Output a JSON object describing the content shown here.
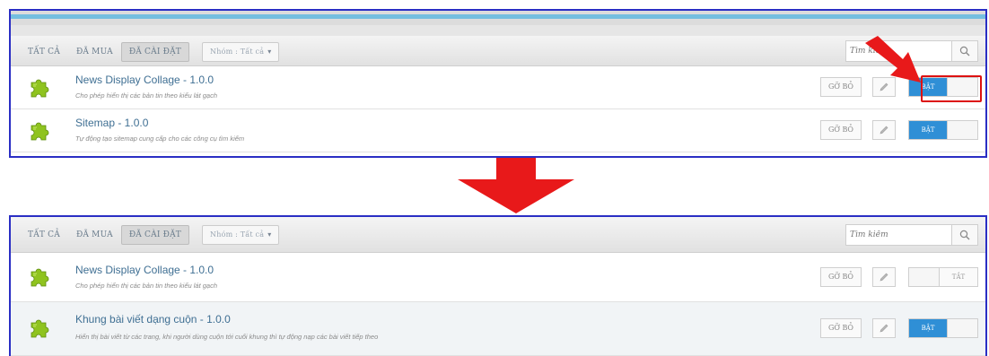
{
  "colors": {
    "accent_blue": "#2f8fd6",
    "highlight_red": "#dd1111",
    "panel_border": "#2a2ec4",
    "title_link": "#3f6f93"
  },
  "top": {
    "tabs": {
      "all": "TẤT CẢ",
      "purchased": "ĐÃ MUA",
      "installed": "ĐÃ CÀI ĐẶT",
      "filter": "Nhóm : Tất cả"
    },
    "search": {
      "placeholder": "Tìm kiếm"
    },
    "rows": [
      {
        "title": "News Display Collage - 1.0.0",
        "desc": "Cho phép hiển thị các bản tin theo kiểu lát gạch",
        "remove": "GỠ BỎ",
        "toggle": "BẬT"
      },
      {
        "title": "Sitemap - 1.0.0",
        "desc": "Tự động tạo sitemap cung cấp cho các công cụ tìm kiếm",
        "remove": "GỠ BỎ",
        "toggle": "BẬT"
      }
    ]
  },
  "bottom": {
    "tabs": {
      "all": "TẤT CẢ",
      "purchased": "ĐÃ MUA",
      "installed": "ĐÃ CÀI ĐẶT",
      "filter": "Nhóm : Tất cả"
    },
    "search": {
      "placeholder": "Tìm kiếm"
    },
    "rows": [
      {
        "title": "News Display Collage - 1.0.0",
        "desc": "Cho phép hiển thị các bản tin theo kiểu lát gạch",
        "remove": "GỠ BỎ",
        "toggle": "TẮT"
      },
      {
        "title": "Khung bài viết dạng cuộn - 1.0.0",
        "desc": "Hiển thị bài viết từ các trang, khi người dùng cuộn tới cuối khung thì tự động nạp các bài viết tiếp theo",
        "remove": "GỠ BỎ",
        "toggle": "BẬT"
      }
    ]
  }
}
